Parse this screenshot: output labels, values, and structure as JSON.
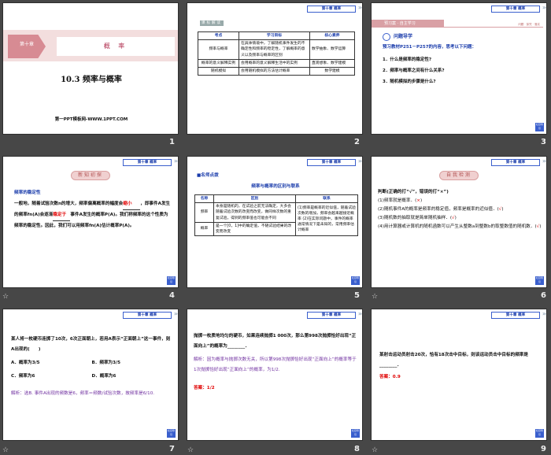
{
  "common": {
    "chapter_tag": "第十章 概率",
    "nav_label": "栏目导引",
    "star_icon": "animation-star-icon"
  },
  "slides": [
    {
      "number": "1",
      "chapter_box": "第十章",
      "chapter_name": "概 率",
      "section": "10.3 频率与概率",
      "footer": "第一PPT模板网-WWW.1PPT.COM"
    },
    {
      "number": "2",
      "tabs": "课标解读",
      "headers": [
        "考点",
        "学习目标",
        "核心素养"
      ],
      "rows": [
        [
          "频率与概率",
          "在具体情境中，了解随机事件发生的不确定性和频率的稳定性，了解概率的意义以及频率与概率的区别",
          "数学抽象、数学运算"
        ],
        [
          "概率的意义解释实例",
          "会用概率的意义解释生活中的实例",
          "直观想象、数学建模"
        ],
        [
          "随机模拟",
          "会用随机模拟的方法估计概率",
          "数学建模"
        ]
      ]
    },
    {
      "number": "3",
      "banner": "预习案 · 自主学习",
      "banner_right": "问题 · 探究 · 落实",
      "heading": "问题导学",
      "intro": "预习教材P251－P257的内容，思考以下问题：",
      "questions": [
        "1．什么是频率的稳定性?",
        "2．频率与概率之间有什么关系?",
        "3．随机模拟的步骤是什么?"
      ]
    },
    {
      "number": "4",
      "badge": "新知初探",
      "title": "频率的稳定性",
      "p1": "一般地，随着试验次数n的增大，频率偏离概率的幅度会",
      "blank1": "缩小",
      "p2": "，即事件A发生的频率fn(A)会逐渐",
      "blank2": "稳定于",
      "p3": "事件A发生的概率P(A)。我们称频率的这个性质为频率的稳定性。因此，我们可以用频率fn(A)估计概率P(A)。"
    },
    {
      "number": "5",
      "label": "■名师点拨",
      "title": "频率与概率的区别与联系",
      "headers": [
        "名称",
        "区别",
        "联系"
      ],
      "rows": [
        [
          "频率",
          "本身是随机的，在试验之前无法确定，大多会随着试验次数的改变而改变，做同样次数的重复试验，得到的频率值也可能会不同"
        ],
        [
          "概率",
          "是一个[0，1]中的确定值，不随试验结果的改变而改变"
        ]
      ],
      "relation": "(1)频率是概率的近似值，随着试验次数的增加，频率会越来越接近概率 (2)在实际问题中，事件的概率通常情况下是未知的，常用频率估计概率"
    },
    {
      "number": "6",
      "badge": "自我检测",
      "intro": "判断(正确的打“√”，错误的打“×”)",
      "items": [
        {
          "text": "(1)频率就是概率．(",
          "ans": "×"
        },
        {
          "text": "(2)随机事件A的概率是频率的稳定值，频率是概率的近似值．(",
          "ans": "√"
        },
        {
          "text": "(3)随机数的抽取就是简单随机抽样．(",
          "ans": "√"
        },
        {
          "text": "(4)用计算器或计算机的随机函数可以产生从整数a到整数b的取整数值的随机数．(",
          "ans": "√"
        }
      ]
    },
    {
      "number": "7",
      "question": "某人将一枚硬币连掷了10次，6次正面朝上，若用A表示“正面朝上”这一事件，则A出现的(　　)",
      "options": [
        "A．概率为3/5",
        "B．频率为3/5",
        "C．频率为6",
        "D．概率为6"
      ],
      "solution": "解析：选B. 事件A出现的频数是6，频率＝频数/试验次数，故频率是6/10."
    },
    {
      "number": "8",
      "question": "抛掷一枚质地均匀的硬币，如果连续抛掷1 000次，那么第998次抛掷恰好出现“正面向上”的概率为________．",
      "solution": "解析：因为概率与抛掷次数无关，所以第998次抛掷恰好出现“正面向上”的概率等于1次抛掷恰好出现“正面向上”的概率，为1/2.",
      "answer_label": "答案：",
      "answer": "1/2"
    },
    {
      "number": "9",
      "question": "某射击运动员射击20次，恰有18次击中目标，则该运动员击中目标的频率是________．",
      "answer_label": "答案：",
      "answer": "0.9"
    }
  ]
}
